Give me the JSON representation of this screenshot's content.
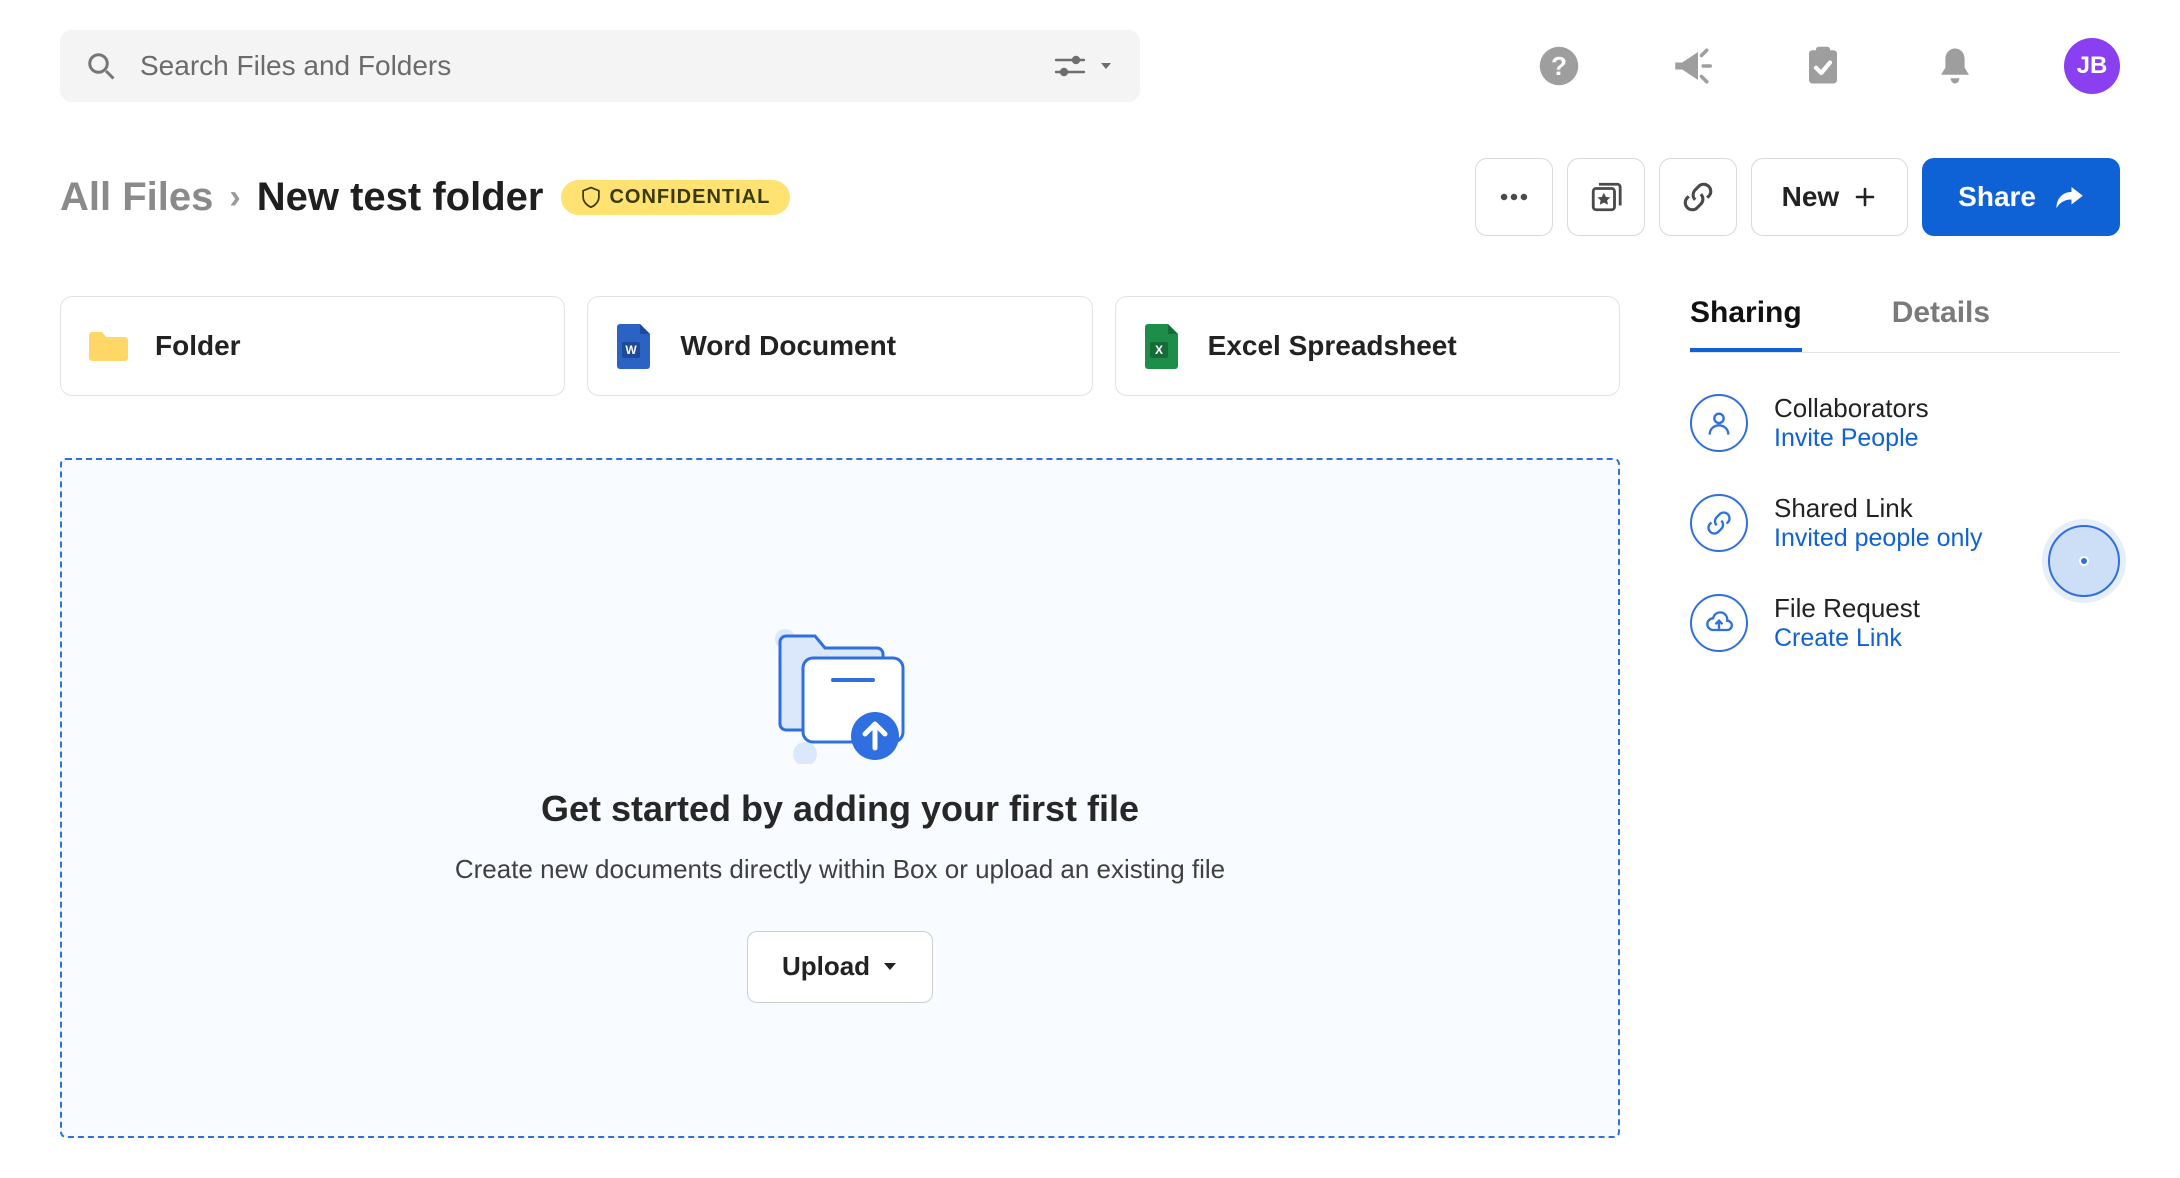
{
  "header": {
    "search_placeholder": "Search Files and Folders",
    "avatar_initials": "JB"
  },
  "breadcrumb": {
    "root": "All Files",
    "separator": "›",
    "current": "New test folder",
    "badge": "CONFIDENTIAL"
  },
  "actions": {
    "new_label": "New",
    "share_label": "Share"
  },
  "templates": {
    "folder": "Folder",
    "word": "Word Document",
    "excel": "Excel Spreadsheet"
  },
  "dropzone": {
    "title": "Get started by adding your first file",
    "subtitle": "Create new documents directly within Box or upload an existing file",
    "upload_label": "Upload"
  },
  "sidebar": {
    "tabs": {
      "sharing": "Sharing",
      "details": "Details"
    },
    "collaborators": {
      "title": "Collaborators",
      "link": "Invite People"
    },
    "shared_link": {
      "title": "Shared Link",
      "link": "Invited people only"
    },
    "file_request": {
      "title": "File Request",
      "link": "Create Link"
    }
  }
}
